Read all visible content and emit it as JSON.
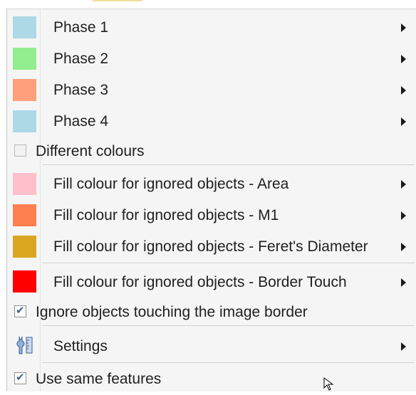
{
  "menu": {
    "phase_items": [
      {
        "label": "Phase 1",
        "color": "#add8e6"
      },
      {
        "label": "Phase 2",
        "color": "#90ee90"
      },
      {
        "label": "Phase 3",
        "color": "#ffa07a"
      },
      {
        "label": "Phase 4",
        "color": "#add8e6"
      }
    ],
    "different_colours": {
      "label": "Different colours",
      "checked": false,
      "enabled": false
    },
    "ignored_items": [
      {
        "label": "Fill colour for ignored objects - Area",
        "color": "#ffc0cb"
      },
      {
        "label": "Fill colour for ignored objects - M1",
        "color": "#ff7f50"
      },
      {
        "label": "Fill colour for ignored objects - Feret's Diameter",
        "color": "#daa520"
      },
      {
        "label": "Fill colour for ignored objects - Border Touch",
        "color": "#ff0000"
      }
    ],
    "ignore_border": {
      "label": "Ignore objects touching the image border",
      "checked": true
    },
    "settings": {
      "label": "Settings",
      "icon": "wrench-ruler-icon"
    },
    "use_same_features": {
      "label": "Use same features",
      "checked": true
    }
  }
}
